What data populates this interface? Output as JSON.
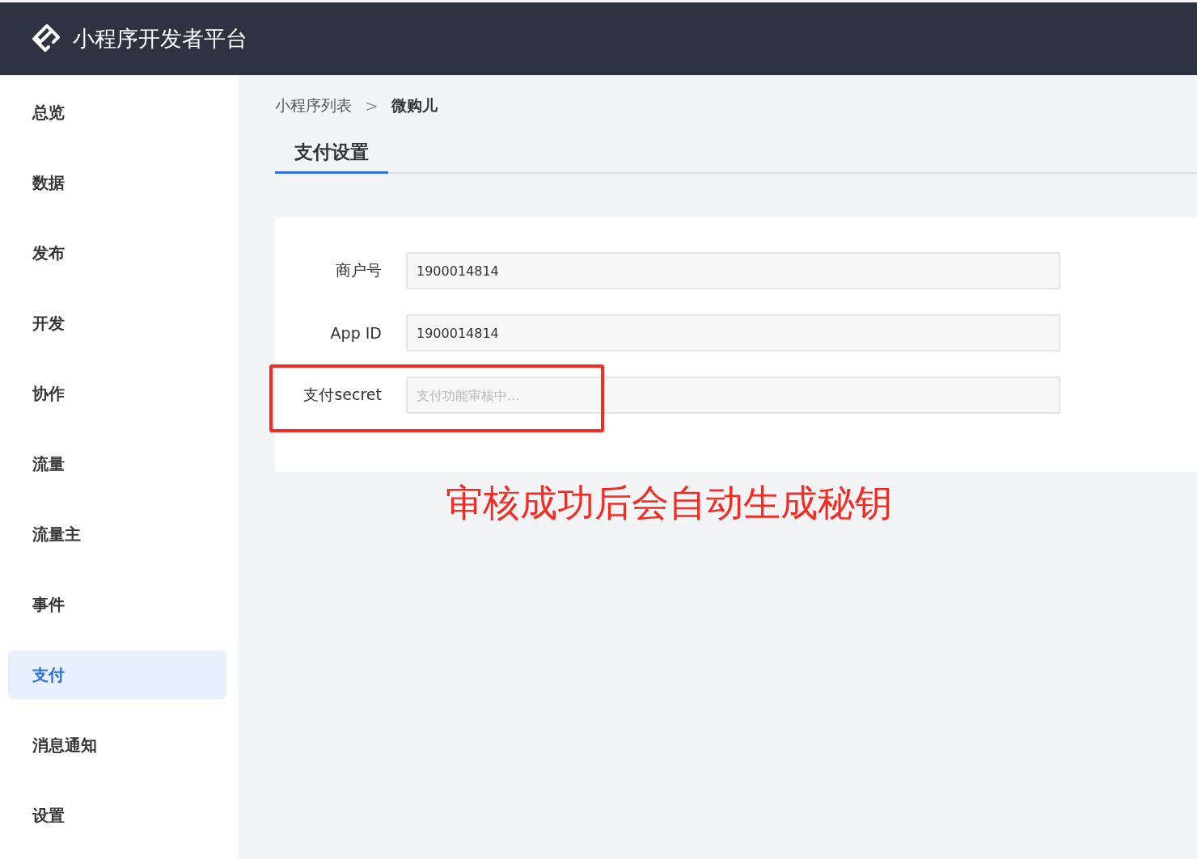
{
  "header": {
    "title": "小程序开发者平台"
  },
  "sidebar": {
    "items": [
      {
        "label": "总览",
        "selected": false
      },
      {
        "label": "数据",
        "selected": false
      },
      {
        "label": "发布",
        "selected": false
      },
      {
        "label": "开发",
        "selected": false
      },
      {
        "label": "协作",
        "selected": false
      },
      {
        "label": "流量",
        "selected": false
      },
      {
        "label": "流量主",
        "selected": false
      },
      {
        "label": "事件",
        "selected": false
      },
      {
        "label": "支付",
        "selected": true
      },
      {
        "label": "消息通知",
        "selected": false
      },
      {
        "label": "设置",
        "selected": false
      }
    ]
  },
  "breadcrumb": {
    "items": [
      "小程序列表",
      "微购儿"
    ],
    "separator": ">"
  },
  "tabs": [
    {
      "label": "支付设置",
      "selected": true
    }
  ],
  "form": {
    "fields": [
      {
        "label": "商户号",
        "value": "1900014814",
        "highlighted": false
      },
      {
        "label": "App ID",
        "value": "1900014814",
        "highlighted": false
      },
      {
        "label": "支付secret",
        "placeholder": "支付功能审核中...",
        "highlighted": true
      }
    ]
  },
  "annotation": {
    "text": "审核成功后会自动生成秘钥"
  }
}
